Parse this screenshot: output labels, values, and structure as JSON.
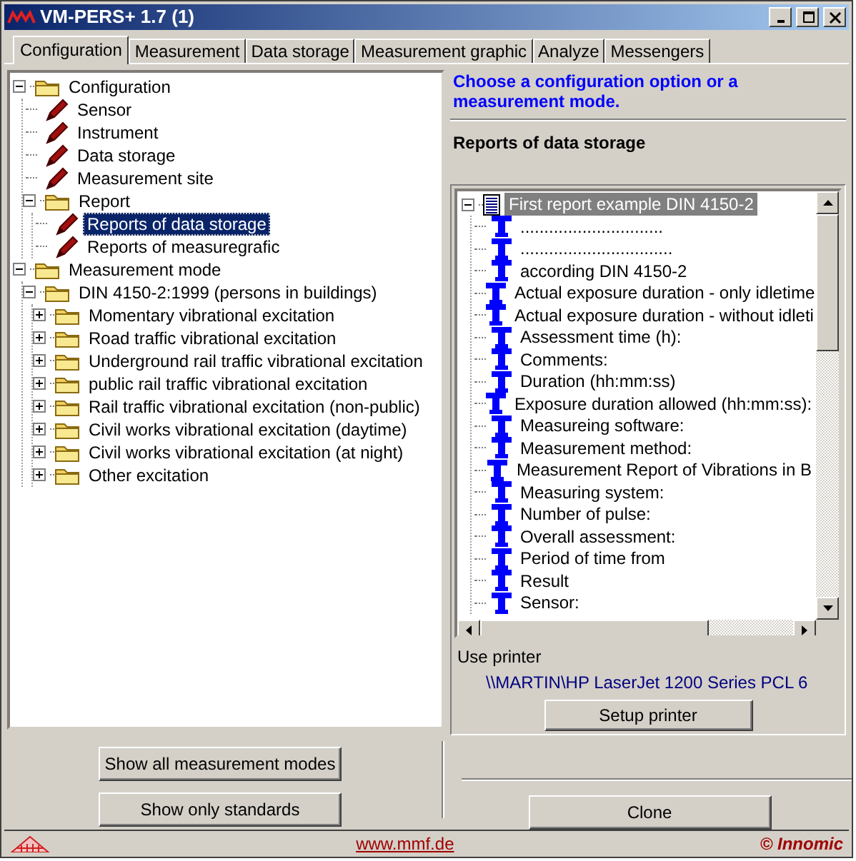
{
  "window": {
    "title": "VM-PERS+ 1.7 (1)"
  },
  "tabs": [
    {
      "label": "Configuration",
      "selected": true
    },
    {
      "label": "Measurement",
      "selected": false
    },
    {
      "label": "Data storage",
      "selected": false
    },
    {
      "label": "Measurement graphic",
      "selected": false
    },
    {
      "label": "Analyze",
      "selected": false
    },
    {
      "label": "Messengers",
      "selected": false
    }
  ],
  "config_tree": [
    {
      "kind": "folder",
      "label": "Configuration",
      "expanded": true,
      "selected": false,
      "children": [
        {
          "kind": "setting",
          "label": "Sensor",
          "selected": false
        },
        {
          "kind": "setting",
          "label": "Instrument",
          "selected": false
        },
        {
          "kind": "setting",
          "label": "Data storage",
          "selected": false
        },
        {
          "kind": "setting",
          "label": "Measurement site",
          "selected": false
        },
        {
          "kind": "folder",
          "label": "Report",
          "expanded": true,
          "selected": false,
          "children": [
            {
              "kind": "setting",
              "label": "Reports of data storage",
              "selected": true
            },
            {
              "kind": "setting",
              "label": "Reports of measuregrafic",
              "selected": false
            }
          ]
        }
      ]
    },
    {
      "kind": "folder",
      "label": "Measurement mode",
      "expanded": true,
      "selected": false,
      "children": [
        {
          "kind": "folder",
          "label": "DIN 4150-2:1999 (persons in buildings)",
          "expanded": true,
          "selected": false,
          "children": [
            {
              "kind": "folder",
              "label": "Momentary vibrational excitation",
              "expanded": false,
              "selected": false
            },
            {
              "kind": "folder",
              "label": "Road traffic vibrational excitation",
              "expanded": false,
              "selected": false
            },
            {
              "kind": "folder",
              "label": "Underground rail traffic vibrational excitation",
              "expanded": false,
              "selected": false
            },
            {
              "kind": "folder",
              "label": "public rail traffic vibrational excitation",
              "expanded": false,
              "selected": false
            },
            {
              "kind": "folder",
              "label": "Rail traffic vibrational excitation (non-public)",
              "expanded": false,
              "selected": false
            },
            {
              "kind": "folder",
              "label": "Civil works vibrational excitation (daytime)",
              "expanded": false,
              "selected": false
            },
            {
              "kind": "folder",
              "label": "Civil works vibrational excitation (at night)",
              "expanded": false,
              "selected": false
            },
            {
              "kind": "folder",
              "label": "Other excitation",
              "expanded": false,
              "selected": false
            }
          ]
        }
      ]
    }
  ],
  "left_buttons": [
    "Show all measurement modes",
    "Show only standards"
  ],
  "hint": "Choose a configuration option or a measurement mode.",
  "section_title": "Reports of data storage",
  "report_tree": [
    {
      "kind": "report",
      "label": "First report example DIN 4150-2",
      "expanded": true,
      "selected": true,
      "children": [
        {
          "kind": "text",
          "label": "..............................",
          "selected": false
        },
        {
          "kind": "text",
          "label": "................................",
          "selected": false
        },
        {
          "kind": "text",
          "label": "according DIN 4150-2",
          "selected": false
        },
        {
          "kind": "text",
          "label": "Actual exposure duration - only idletime",
          "selected": false
        },
        {
          "kind": "text",
          "label": "Actual exposure duration - without idleti",
          "selected": false
        },
        {
          "kind": "text",
          "label": "Assessment time (h):",
          "selected": false
        },
        {
          "kind": "text",
          "label": "Comments:",
          "selected": false
        },
        {
          "kind": "text",
          "label": "Duration (hh:mm:ss)",
          "selected": false
        },
        {
          "kind": "text",
          "label": "Exposure duration allowed (hh:mm:ss):",
          "selected": false
        },
        {
          "kind": "text",
          "label": "Measureing software:",
          "selected": false
        },
        {
          "kind": "text",
          "label": "Measurement method:",
          "selected": false
        },
        {
          "kind": "text",
          "label": "Measurement Report of Vibrations in B",
          "selected": false
        },
        {
          "kind": "text",
          "label": "Measuring system:",
          "selected": false
        },
        {
          "kind": "text",
          "label": "Number of pulse:",
          "selected": false
        },
        {
          "kind": "text",
          "label": "Overall assessment:",
          "selected": false
        },
        {
          "kind": "text",
          "label": "Period of time from",
          "selected": false
        },
        {
          "kind": "text",
          "label": "Result",
          "selected": false
        },
        {
          "kind": "text",
          "label": "Sensor:",
          "selected": false
        }
      ]
    }
  ],
  "printer": {
    "label": "Use printer",
    "name": "\\\\MARTIN\\HP LaserJet 1200 Series PCL 6",
    "button": "Setup printer"
  },
  "right_buttons": [
    "Clone"
  ],
  "footer": {
    "link": "www.mmf.de",
    "copyright": "© Innomic"
  }
}
